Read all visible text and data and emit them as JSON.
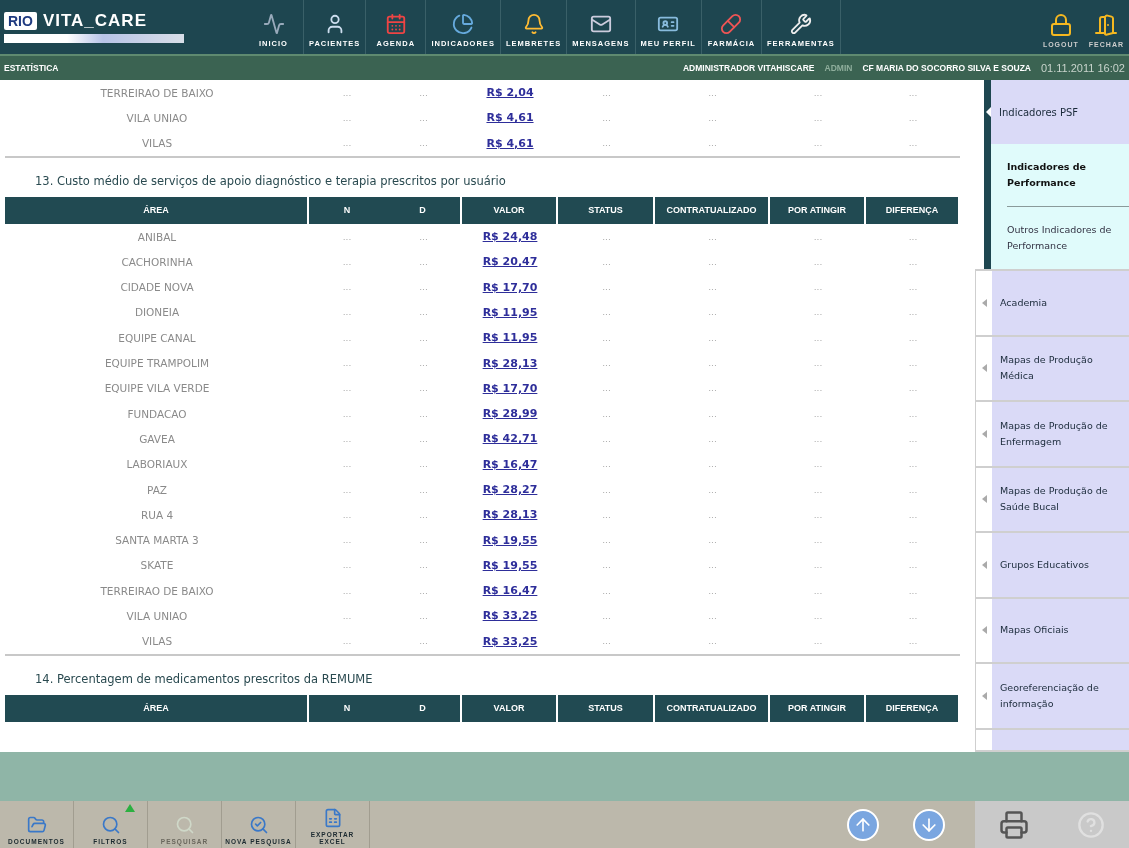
{
  "logo": {
    "rio": "RIO",
    "vitacare": "VITA_CARE"
  },
  "nav": [
    {
      "label": "INICIO"
    },
    {
      "label": "PACIENTES"
    },
    {
      "label": "AGENDA"
    },
    {
      "label": "INDICADORES"
    },
    {
      "label": "LEMBRETES"
    },
    {
      "label": "MENSAGENS"
    },
    {
      "label": "MEU PERFIL"
    },
    {
      "label": "FARMÁCIA"
    },
    {
      "label": "FERRAMENTAS"
    }
  ],
  "session": [
    {
      "label": "LOGOUT"
    },
    {
      "label": "FECHAR"
    }
  ],
  "subbar": {
    "section": "ESTATÍSTICA",
    "user": "ADMINISTRADOR VITAHISCARE",
    "role": "ADMIN",
    "unit": "CF MARIA DO SOCORRO SILVA E SOUZA",
    "datetime": "01.11.2011 16:02"
  },
  "sections": [
    {
      "rows": [
        {
          "area": "TERREIRAO DE BAIXO",
          "n": "...",
          "d": "...",
          "valor": "R$ 2,04",
          "status": "...",
          "contratualizado": "...",
          "por_atingir": "...",
          "diferenca": "..."
        },
        {
          "area": "VILA UNIAO",
          "n": "...",
          "d": "...",
          "valor": "R$ 4,61",
          "status": "...",
          "contratualizado": "...",
          "por_atingir": "...",
          "diferenca": "..."
        },
        {
          "area": "VILAS",
          "n": "...",
          "d": "...",
          "valor": "R$ 4,61",
          "status": "...",
          "contratualizado": "...",
          "por_atingir": "...",
          "diferenca": "..."
        }
      ]
    },
    {
      "title": "13. Custo médio de serviços de apoio diagnóstico e terapia prescritos por usuário",
      "columns": [
        "ÁREA",
        "N",
        "D",
        "VALOR",
        "STATUS",
        "CONTRATUALIZADO",
        "POR ATINGIR",
        "DIFERENÇA"
      ],
      "rows": [
        {
          "area": "ANIBAL",
          "n": "...",
          "d": "...",
          "valor": "R$ 24,48",
          "status": "...",
          "contratualizado": "...",
          "por_atingir": "...",
          "diferenca": "..."
        },
        {
          "area": "CACHORINHA",
          "n": "...",
          "d": "...",
          "valor": "R$ 20,47",
          "status": "...",
          "contratualizado": "...",
          "por_atingir": "...",
          "diferenca": "..."
        },
        {
          "area": "CIDADE NOVA",
          "n": "...",
          "d": "...",
          "valor": "R$ 17,70",
          "status": "...",
          "contratualizado": "...",
          "por_atingir": "...",
          "diferenca": "..."
        },
        {
          "area": "DIONEIA",
          "n": "...",
          "d": "...",
          "valor": "R$ 11,95",
          "status": "...",
          "contratualizado": "...",
          "por_atingir": "...",
          "diferenca": "..."
        },
        {
          "area": "EQUIPE CANAL",
          "n": "...",
          "d": "...",
          "valor": "R$ 11,95",
          "status": "...",
          "contratualizado": "...",
          "por_atingir": "...",
          "diferenca": "..."
        },
        {
          "area": "EQUIPE TRAMPOLIM",
          "n": "...",
          "d": "...",
          "valor": "R$ 28,13",
          "status": "...",
          "contratualizado": "...",
          "por_atingir": "...",
          "diferenca": "..."
        },
        {
          "area": "EQUIPE VILA VERDE",
          "n": "...",
          "d": "...",
          "valor": "R$ 17,70",
          "status": "...",
          "contratualizado": "...",
          "por_atingir": "...",
          "diferenca": "..."
        },
        {
          "area": "FUNDACAO",
          "n": "...",
          "d": "...",
          "valor": "R$ 28,99",
          "status": "...",
          "contratualizado": "...",
          "por_atingir": "...",
          "diferenca": "..."
        },
        {
          "area": "GAVEA",
          "n": "...",
          "d": "...",
          "valor": "R$ 42,71",
          "status": "...",
          "contratualizado": "...",
          "por_atingir": "...",
          "diferenca": "..."
        },
        {
          "area": "LABORIAUX",
          "n": "...",
          "d": "...",
          "valor": "R$ 16,47",
          "status": "...",
          "contratualizado": "...",
          "por_atingir": "...",
          "diferenca": "..."
        },
        {
          "area": "PAZ",
          "n": "...",
          "d": "...",
          "valor": "R$ 28,27",
          "status": "...",
          "contratualizado": "...",
          "por_atingir": "...",
          "diferenca": "..."
        },
        {
          "area": "RUA 4",
          "n": "...",
          "d": "...",
          "valor": "R$ 28,13",
          "status": "...",
          "contratualizado": "...",
          "por_atingir": "...",
          "diferenca": "..."
        },
        {
          "area": "SANTA MARTA 3",
          "n": "...",
          "d": "...",
          "valor": "R$ 19,55",
          "status": "...",
          "contratualizado": "...",
          "por_atingir": "...",
          "diferenca": "..."
        },
        {
          "area": "SKATE",
          "n": "...",
          "d": "...",
          "valor": "R$ 19,55",
          "status": "...",
          "contratualizado": "...",
          "por_atingir": "...",
          "diferenca": "..."
        },
        {
          "area": "TERREIRAO DE BAIXO",
          "n": "...",
          "d": "...",
          "valor": "R$ 16,47",
          "status": "...",
          "contratualizado": "...",
          "por_atingir": "...",
          "diferenca": "..."
        },
        {
          "area": "VILA UNIAO",
          "n": "...",
          "d": "...",
          "valor": "R$ 33,25",
          "status": "...",
          "contratualizado": "...",
          "por_atingir": "...",
          "diferenca": "..."
        },
        {
          "area": "VILAS",
          "n": "...",
          "d": "...",
          "valor": "R$ 33,25",
          "status": "...",
          "contratualizado": "...",
          "por_atingir": "...",
          "diferenca": "..."
        }
      ]
    },
    {
      "title": "14. Percentagem de medicamentos prescritos da REMUME",
      "columns": [
        "ÁREA",
        "N",
        "D",
        "VALOR",
        "STATUS",
        "CONTRATUALIZADO",
        "POR ATINGIR",
        "DIFERENÇA"
      ]
    }
  ],
  "sidebar": {
    "items": [
      {
        "label": "Indicadores PSF",
        "expanded": true,
        "children": [
          {
            "label": "Indicadores de Performance",
            "selected": true
          },
          {
            "label": "Outros Indicadores de Performance",
            "selected": false
          }
        ]
      },
      {
        "label": "Academia",
        "expanded": false
      },
      {
        "label": "Mapas de Produção Médica",
        "expanded": false
      },
      {
        "label": "Mapas de Produção de Enfermagem",
        "expanded": false
      },
      {
        "label": "Mapas de Produção de Saúde Bucal",
        "expanded": false
      },
      {
        "label": "Grupos Educativos",
        "expanded": false
      },
      {
        "label": "Mapas Oficiais",
        "expanded": false
      },
      {
        "label": "Georeferenciação de informação",
        "expanded": false
      }
    ]
  },
  "toolbar": [
    {
      "label": "DOCUMENTOS",
      "disabled": false
    },
    {
      "label": "FILTROS",
      "disabled": false
    },
    {
      "label": "PESQUISAR",
      "disabled": true
    },
    {
      "label": "NOVA PESQUISA",
      "disabled": false
    },
    {
      "label": "EXPORTAR EXCEL",
      "disabled": false
    }
  ]
}
